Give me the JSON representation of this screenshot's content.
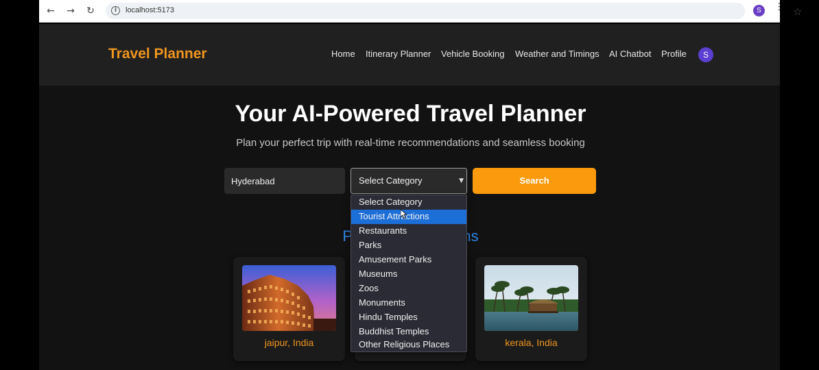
{
  "browser": {
    "url": "localhost:5173",
    "profile_initial": "S"
  },
  "navbar": {
    "brand": "Travel Planner",
    "links": [
      "Home",
      "Itinerary Planner",
      "Vehicle Booking",
      "Weather and Timings",
      "AI Chatbot",
      "Profile"
    ],
    "avatar_initial": "S"
  },
  "hero": {
    "title": "Your AI-Powered Travel Planner",
    "subtitle": "Plan your perfect trip with real-time recommendations and seamless booking"
  },
  "search": {
    "city_value": "Hyderabad",
    "category_selected": "Select Category",
    "button_label": "Search"
  },
  "dropdown": {
    "options": [
      "Select Category",
      "Tourist Attractions",
      "Restaurants",
      "Parks",
      "Amusement Parks",
      "Museums",
      "Zoos",
      "Monuments",
      "Hindu Temples",
      "Buddhist Temples",
      "Other Religious Places"
    ],
    "highlighted": "Tourist Attractions"
  },
  "section": {
    "title_left": "Po",
    "title_right": "ns"
  },
  "destinations": [
    {
      "label": "jaipur, India",
      "icon": "hawa-mahal-image"
    },
    {
      "label": "kerala, India",
      "icon": "backwaters-image"
    }
  ],
  "colors": {
    "brand": "#f0951f",
    "accent_button": "#fb9a0c",
    "section_title": "#2f86e8",
    "dropdown_highlight": "#1d6fd8"
  }
}
